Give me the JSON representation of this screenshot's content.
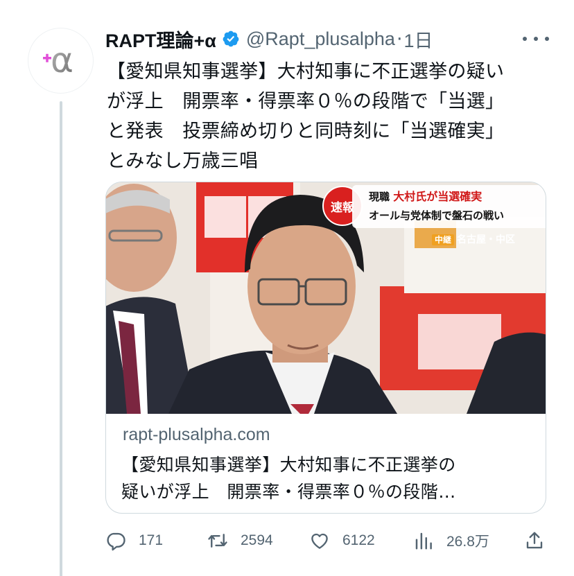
{
  "tweet": {
    "author": {
      "display_name": "RAPT理論+α",
      "handle": "@Rapt_plusalpha",
      "verified": true,
      "avatar_icon": "alpha-plus-logo-icon"
    },
    "separator": "·",
    "time": "1日",
    "text_lines": [
      "【愛知県知事選挙】大村知事に不正選挙の疑い",
      "が浮上　開票率・得票率０％の段階で「当選」",
      "と発表　投票締め切りと同時刻に「当選確実」",
      "とみなし万歳三唱"
    ]
  },
  "card": {
    "domain": "rapt-plusalpha.com",
    "title_lines": [
      "【愛知県知事選挙】大村知事に不正選挙の",
      "疑いが浮上　開票率・得票率０％の段階…"
    ],
    "thumbnail": {
      "badge": "速報",
      "headline_prefix": "現職",
      "headline_highlight": "大村氏が当選確実",
      "headline_line2": "オール与党体制で盤石の戦い",
      "relay_tag": "中継",
      "location": "名古屋・中区"
    }
  },
  "actions": {
    "reply": {
      "icon": "reply-icon",
      "count": "171"
    },
    "retweet": {
      "icon": "retweet-icon",
      "count": "2594"
    },
    "like": {
      "icon": "like-icon",
      "count": "6122"
    },
    "views": {
      "icon": "views-icon",
      "count": "26.8万"
    },
    "share": {
      "icon": "share-icon"
    }
  },
  "colors": {
    "text_primary": "#0f1419",
    "text_secondary": "#536471",
    "verified_blue": "#1d9bf0",
    "border": "#cfd9de",
    "logo_pink": "#e14fd8"
  }
}
